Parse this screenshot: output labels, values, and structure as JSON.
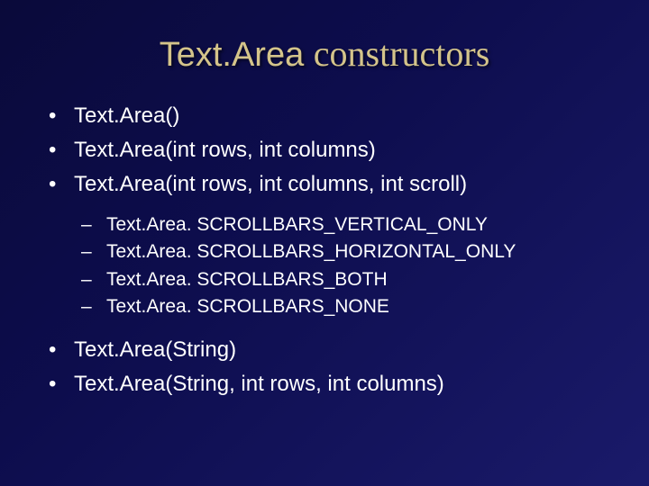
{
  "title": {
    "part1": "Text.Area ",
    "part2": "constructors"
  },
  "bullets": [
    {
      "text": "Text.Area()"
    },
    {
      "text": "Text.Area(int rows, int columns)"
    },
    {
      "text": "Text.Area(int rows, int columns, int scroll)"
    }
  ],
  "sub_bullets": [
    {
      "text": "Text.Area. SCROLLBARS_VERTICAL_ONLY"
    },
    {
      "text": "Text.Area. SCROLLBARS_HORIZONTAL_ONLY"
    },
    {
      "text": "Text.Area. SCROLLBARS_BOTH"
    },
    {
      "text": "Text.Area. SCROLLBARS_NONE"
    }
  ],
  "bullets2": [
    {
      "text": "Text.Area(String)"
    },
    {
      "text": "Text.Area(String, int rows, int columns)"
    }
  ]
}
